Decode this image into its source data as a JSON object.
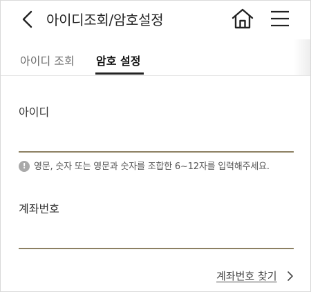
{
  "header": {
    "title": "아이디조회/암호설정",
    "back_icon": "chevron-left-icon",
    "home_icon": "home-icon",
    "menu_icon": "hamburger-menu-icon"
  },
  "tabs": [
    {
      "label": "아이디 조회",
      "active": false
    },
    {
      "label": "암호 설정",
      "active": true
    }
  ],
  "form": {
    "id_label": "아이디",
    "id_value": "",
    "hint": "영문, 숫자 또는 영문과 숫자를 조합한 6~12자를 입력해주세요.",
    "account_label": "계좌번호",
    "account_value": ""
  },
  "links": {
    "find_account": "계좌번호 찾기"
  },
  "colors": {
    "field_underline": "#8c8062",
    "active_tab_underline": "#222222"
  }
}
